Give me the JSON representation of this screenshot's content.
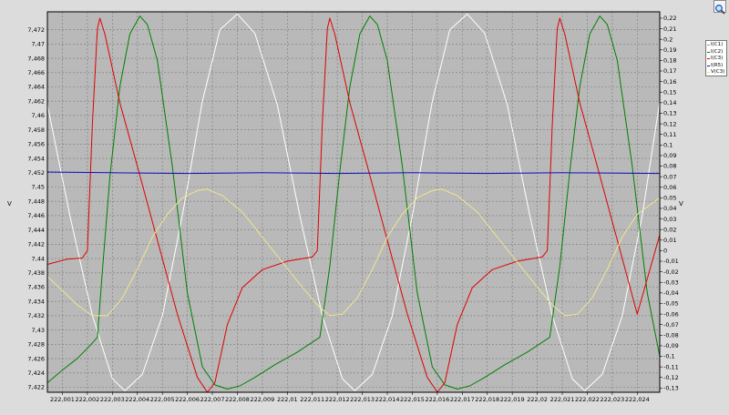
{
  "toolbar": {
    "zoom_icon": "magnifier-icon"
  },
  "chart_data": {
    "type": "line",
    "grid": true,
    "legend_position": "right",
    "xlim": [
      222.0004,
      222.0249
    ],
    "x_ticks": [
      "222,001",
      "222,002",
      "222,003",
      "222,004",
      "222,005",
      "222,006",
      "222,007",
      "222,008",
      "222,009",
      "222,01",
      "222,011",
      "222,012",
      "222,013",
      "222,014",
      "222,015",
      "222,016",
      "222,017",
      "222,018",
      "222,019",
      "222,02",
      "222,021",
      "222,022",
      "222,023",
      "222,024"
    ],
    "left_axis": {
      "label": "V",
      "ylim": [
        7.4213,
        7.4745
      ],
      "ticks": [
        "7,472",
        "7,47",
        "7,468",
        "7,466",
        "7,464",
        "7,462",
        "7,46",
        "7,458",
        "7,456",
        "7,454",
        "7,452",
        "7,45",
        "7,448",
        "7,446",
        "7,444",
        "7,442",
        "7,44",
        "7,438",
        "7,436",
        "7,434",
        "7,432",
        "7,43",
        "7,428",
        "7,426",
        "7,424",
        "7,422"
      ]
    },
    "right_axis": {
      "label": "V",
      "ylim": [
        -0.134,
        0.226
      ],
      "ticks": [
        "0,22",
        "0,21",
        "0,2",
        "0,19",
        "0,18",
        "0,17",
        "0,16",
        "0,15",
        "0,14",
        "0,13",
        "0,12",
        "0,11",
        "0,1",
        "0,09",
        "0,08",
        "0,07",
        "0,06",
        "0,05",
        "0,04",
        "0,03",
        "0,02",
        "0,01",
        "0",
        "-0,01",
        "-0,02",
        "-0,03",
        "-0,04",
        "-0,05",
        "-0,06",
        "-0,07",
        "-0,08",
        "-0,09",
        "-0,1",
        "-0,11",
        "-0,12",
        "-0,13"
      ]
    },
    "series": [
      {
        "name": "I(C1)",
        "color": "#ffffff",
        "axis": "left",
        "points": [
          [
            222.0004,
            7.4615
          ],
          [
            222.0013,
            7.446
          ],
          [
            222.0022,
            7.432
          ],
          [
            222.003,
            7.4232
          ],
          [
            222.0035,
            7.4215
          ],
          [
            222.0042,
            7.4238
          ],
          [
            222.005,
            7.432
          ],
          [
            222.0058,
            7.446
          ],
          [
            222.0066,
            7.462
          ],
          [
            222.0073,
            7.472
          ],
          [
            222.008,
            7.4742
          ],
          [
            222.0087,
            7.4715
          ],
          [
            222.0096,
            7.4615
          ],
          [
            222.0105,
            7.446
          ],
          [
            222.0114,
            7.432
          ],
          [
            222.0122,
            7.4232
          ],
          [
            222.0127,
            7.4215
          ],
          [
            222.0134,
            7.4238
          ],
          [
            222.0142,
            7.432
          ],
          [
            222.015,
            7.446
          ],
          [
            222.0158,
            7.462
          ],
          [
            222.0165,
            7.472
          ],
          [
            222.0172,
            7.4742
          ],
          [
            222.0179,
            7.4715
          ],
          [
            222.0188,
            7.4615
          ],
          [
            222.0197,
            7.446
          ],
          [
            222.0206,
            7.432
          ],
          [
            222.0214,
            7.4232
          ],
          [
            222.0219,
            7.4215
          ],
          [
            222.0226,
            7.4238
          ],
          [
            222.0234,
            7.432
          ],
          [
            222.0242,
            7.446
          ],
          [
            222.0249,
            7.462
          ]
        ]
      },
      {
        "name": "I(C2)",
        "color": "#008000",
        "axis": "right",
        "points": [
          [
            222.0004,
            -0.125
          ],
          [
            222.001,
            -0.113
          ],
          [
            222.0016,
            -0.102
          ],
          [
            222.0021,
            -0.09
          ],
          [
            222.0024,
            -0.082
          ],
          [
            222.0026,
            -0.02
          ],
          [
            222.0029,
            0.07
          ],
          [
            222.0033,
            0.155
          ],
          [
            222.0037,
            0.205
          ],
          [
            222.0041,
            0.222
          ],
          [
            222.0044,
            0.214
          ],
          [
            222.0048,
            0.18
          ],
          [
            222.0054,
            0.08
          ],
          [
            222.006,
            -0.04
          ],
          [
            222.0066,
            -0.11
          ],
          [
            222.0071,
            -0.127
          ],
          [
            222.0076,
            -0.131
          ],
          [
            222.0081,
            -0.128
          ],
          [
            222.0087,
            -0.12
          ],
          [
            222.0095,
            -0.108
          ],
          [
            222.0104,
            -0.096
          ],
          [
            222.0113,
            -0.082
          ],
          [
            222.0117,
            -0.015
          ],
          [
            222.0121,
            0.075
          ],
          [
            222.0125,
            0.155
          ],
          [
            222.0129,
            0.205
          ],
          [
            222.0133,
            0.222
          ],
          [
            222.0136,
            0.214
          ],
          [
            222.014,
            0.18
          ],
          [
            222.0146,
            0.08
          ],
          [
            222.0152,
            -0.04
          ],
          [
            222.0158,
            -0.11
          ],
          [
            222.0163,
            -0.127
          ],
          [
            222.0168,
            -0.131
          ],
          [
            222.0173,
            -0.128
          ],
          [
            222.0179,
            -0.12
          ],
          [
            222.0187,
            -0.108
          ],
          [
            222.0196,
            -0.096
          ],
          [
            222.0205,
            -0.082
          ],
          [
            222.0209,
            -0.015
          ],
          [
            222.0213,
            0.075
          ],
          [
            222.0217,
            0.155
          ],
          [
            222.0221,
            0.205
          ],
          [
            222.0225,
            0.222
          ],
          [
            222.0228,
            0.214
          ],
          [
            222.0232,
            0.18
          ],
          [
            222.0238,
            0.08
          ],
          [
            222.0244,
            -0.04
          ],
          [
            222.0249,
            -0.1
          ]
        ]
      },
      {
        "name": "I(C3)",
        "color": "#e00000",
        "axis": "right",
        "points": [
          [
            222.0004,
            -0.013
          ],
          [
            222.0012,
            -0.008
          ],
          [
            222.0018,
            -0.007
          ],
          [
            222.002,
            0.0
          ],
          [
            222.0022,
            0.12
          ],
          [
            222.0024,
            0.21
          ],
          [
            222.0025,
            0.22
          ],
          [
            222.0027,
            0.205
          ],
          [
            222.0033,
            0.14
          ],
          [
            222.004,
            0.08
          ],
          [
            222.0048,
            0.01
          ],
          [
            222.0056,
            -0.06
          ],
          [
            222.0064,
            -0.12
          ],
          [
            222.0068,
            -0.134
          ],
          [
            222.0071,
            -0.125
          ],
          [
            222.0076,
            -0.07
          ],
          [
            222.0082,
            -0.035
          ],
          [
            222.009,
            -0.018
          ],
          [
            222.01,
            -0.01
          ],
          [
            222.011,
            -0.006
          ],
          [
            222.0112,
            0.0
          ],
          [
            222.0114,
            0.12
          ],
          [
            222.0116,
            0.21
          ],
          [
            222.0117,
            0.22
          ],
          [
            222.0119,
            0.205
          ],
          [
            222.0125,
            0.14
          ],
          [
            222.0132,
            0.08
          ],
          [
            222.014,
            0.01
          ],
          [
            222.0148,
            -0.06
          ],
          [
            222.0156,
            -0.12
          ],
          [
            222.016,
            -0.134
          ],
          [
            222.0163,
            -0.125
          ],
          [
            222.0168,
            -0.07
          ],
          [
            222.0174,
            -0.035
          ],
          [
            222.0182,
            -0.018
          ],
          [
            222.0192,
            -0.01
          ],
          [
            222.0202,
            -0.006
          ],
          [
            222.0204,
            0.0
          ],
          [
            222.0206,
            0.12
          ],
          [
            222.0208,
            0.21
          ],
          [
            222.0209,
            0.22
          ],
          [
            222.0211,
            0.205
          ],
          [
            222.0217,
            0.14
          ],
          [
            222.0224,
            0.08
          ],
          [
            222.0232,
            0.01
          ],
          [
            222.024,
            -0.06
          ],
          [
            222.0249,
            0.015
          ]
        ]
      },
      {
        "name": "I(R5)",
        "color": "#1010c0",
        "axis": "left",
        "points": [
          [
            222.0004,
            7.4521
          ],
          [
            222.003,
            7.452
          ],
          [
            222.006,
            7.4519
          ],
          [
            222.009,
            7.452
          ],
          [
            222.012,
            7.4519
          ],
          [
            222.015,
            7.452
          ],
          [
            222.018,
            7.4519
          ],
          [
            222.021,
            7.452
          ],
          [
            222.0249,
            7.4519
          ]
        ]
      },
      {
        "name": "V(C3)",
        "color": "#f0e68c",
        "axis": "left",
        "points": [
          [
            222.0004,
            7.4375
          ],
          [
            222.001,
            7.4355
          ],
          [
            222.0016,
            7.4335
          ],
          [
            222.0022,
            7.432
          ],
          [
            222.0028,
            7.432
          ],
          [
            222.0034,
            7.4345
          ],
          [
            222.004,
            7.4385
          ],
          [
            222.0046,
            7.443
          ],
          [
            222.0052,
            7.4462
          ],
          [
            222.0058,
            7.4485
          ],
          [
            222.0064,
            7.4495
          ],
          [
            222.0068,
            7.4497
          ],
          [
            222.0074,
            7.4488
          ],
          [
            222.0082,
            7.4465
          ],
          [
            222.009,
            7.443
          ],
          [
            222.0098,
            7.4395
          ],
          [
            222.0106,
            7.436
          ],
          [
            222.0112,
            7.4335
          ],
          [
            222.0117,
            7.432
          ],
          [
            222.0122,
            7.4322
          ],
          [
            222.0128,
            7.4345
          ],
          [
            222.0134,
            7.4385
          ],
          [
            222.014,
            7.443
          ],
          [
            222.0146,
            7.4462
          ],
          [
            222.0152,
            7.4485
          ],
          [
            222.0158,
            7.4495
          ],
          [
            222.0162,
            7.4497
          ],
          [
            222.0168,
            7.4488
          ],
          [
            222.0176,
            7.4465
          ],
          [
            222.0184,
            7.443
          ],
          [
            222.0192,
            7.4395
          ],
          [
            222.02,
            7.436
          ],
          [
            222.0206,
            7.4335
          ],
          [
            222.0211,
            7.432
          ],
          [
            222.0216,
            7.4322
          ],
          [
            222.0222,
            7.4345
          ],
          [
            222.0228,
            7.4385
          ],
          [
            222.0234,
            7.443
          ],
          [
            222.024,
            7.4462
          ],
          [
            222.0249,
            7.4485
          ]
        ]
      }
    ]
  }
}
